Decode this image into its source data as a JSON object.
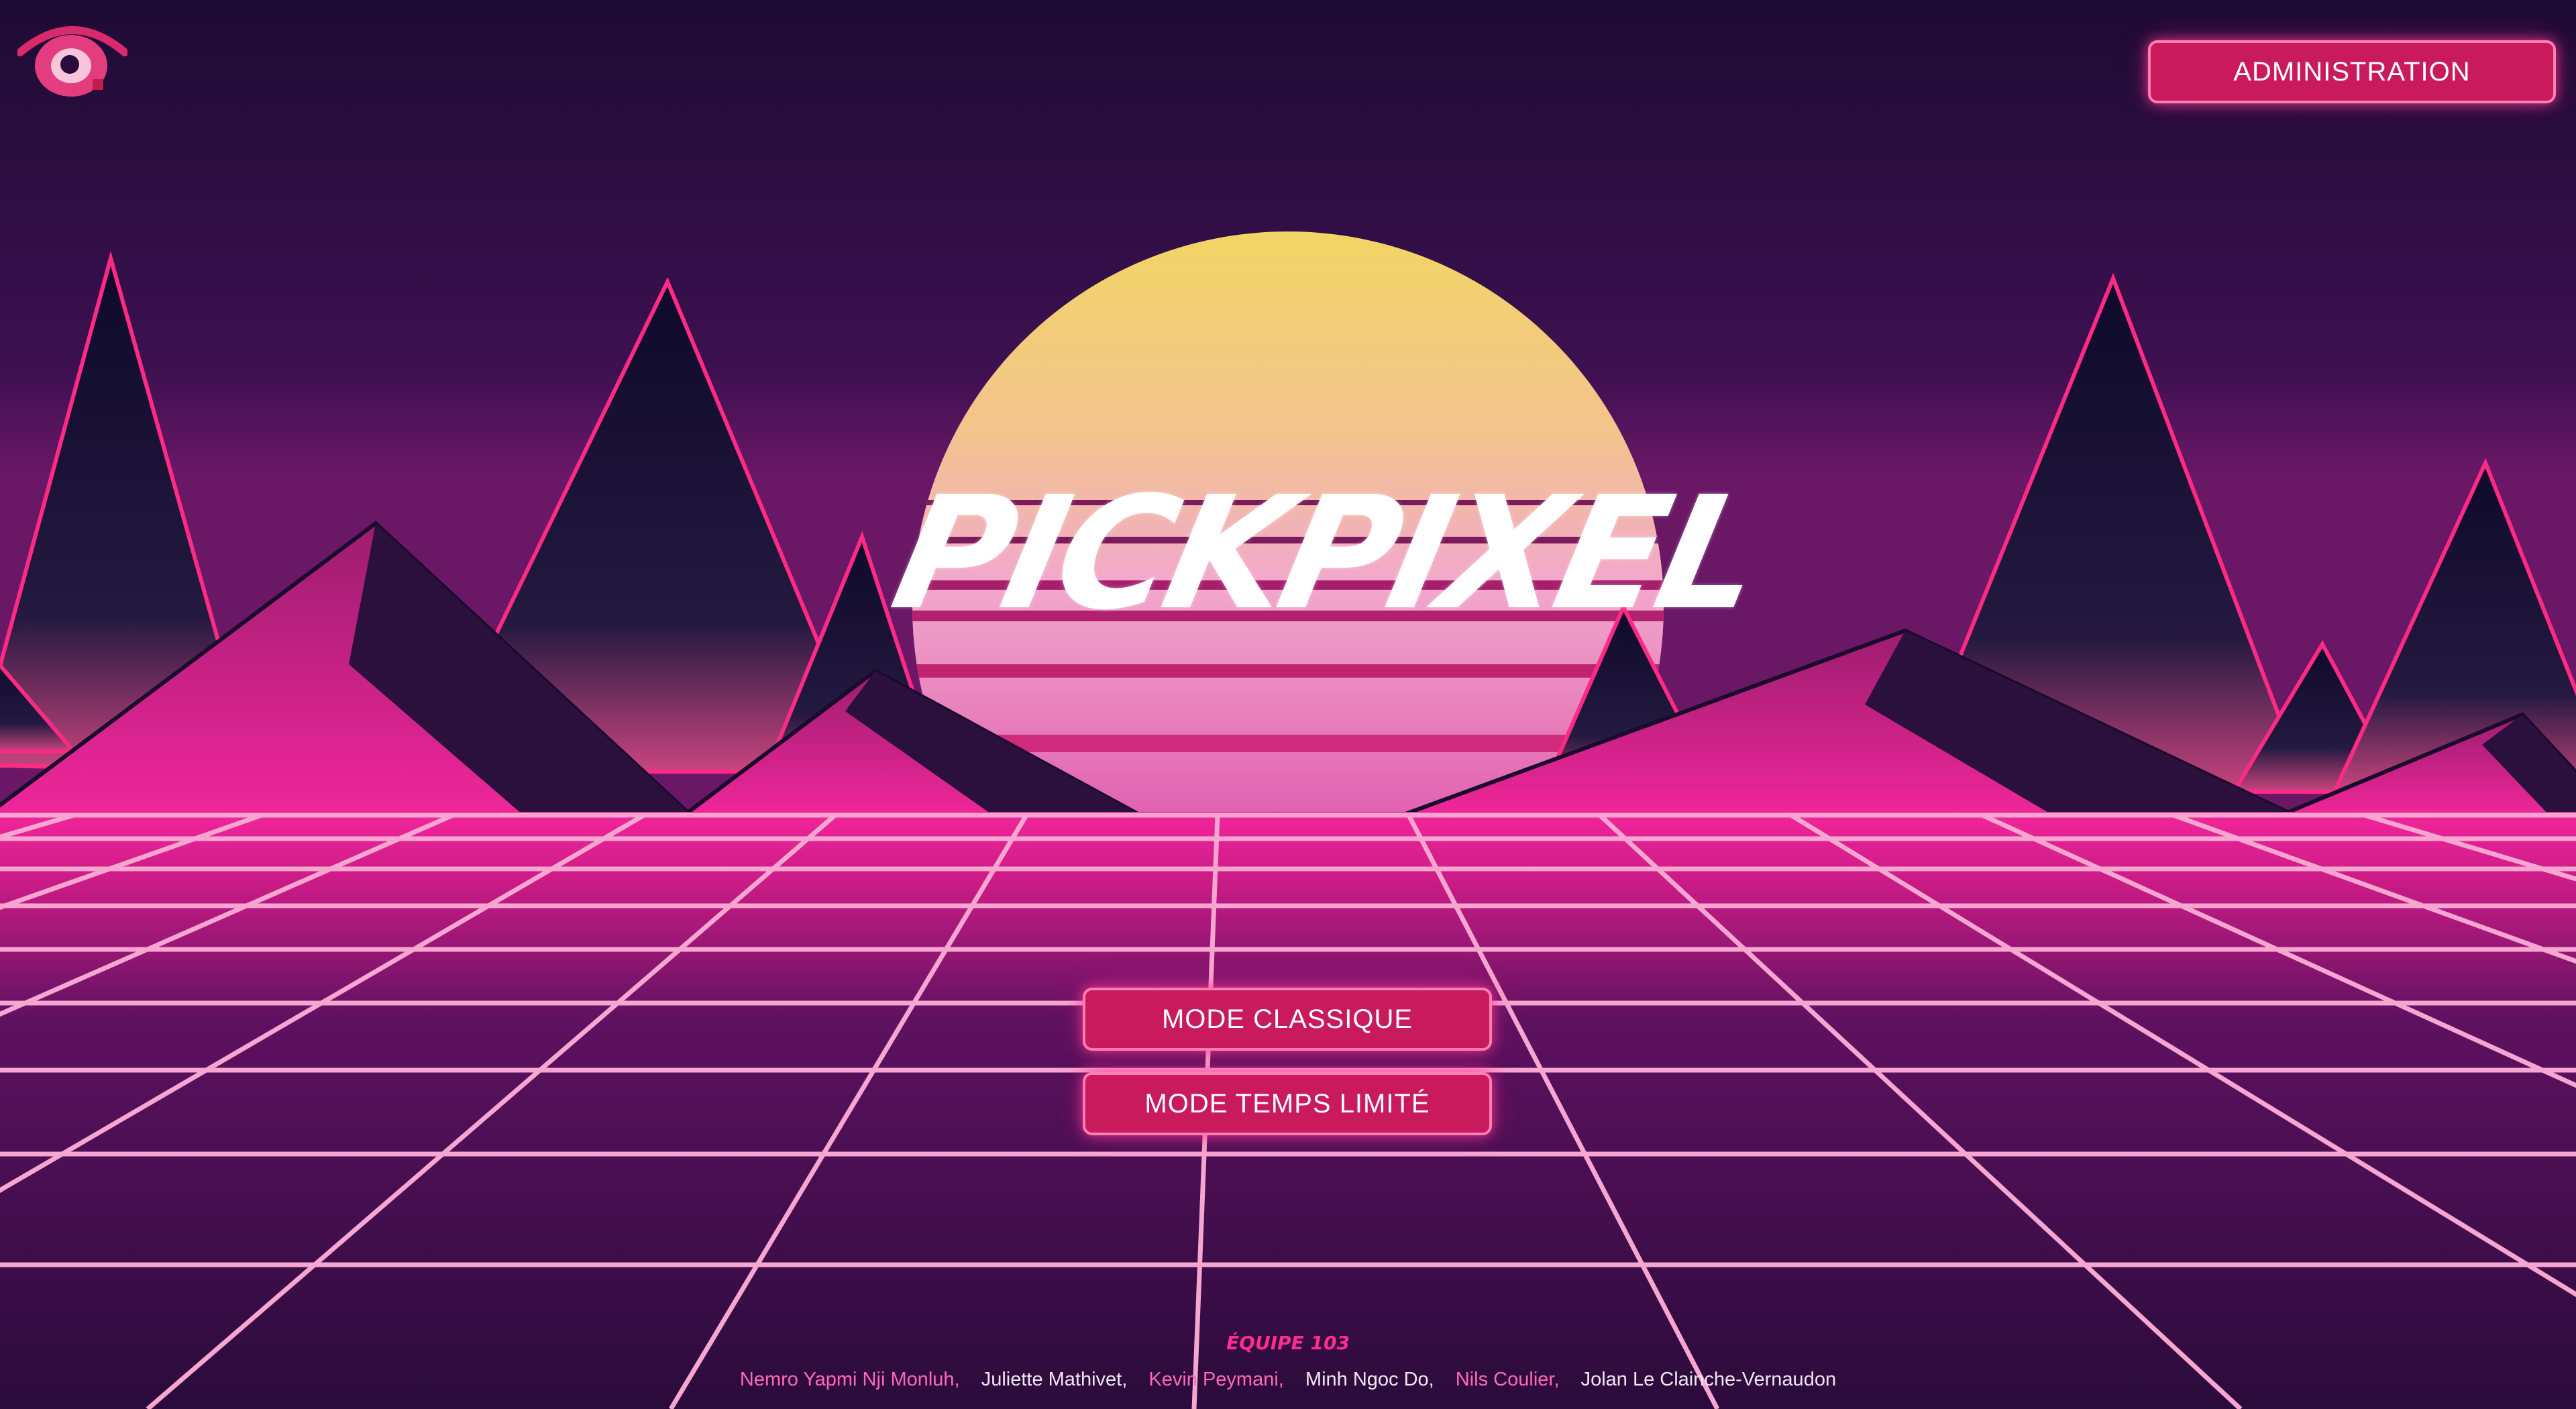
{
  "header": {
    "logo_icon": "eye-pin-logo-icon",
    "admin_label": "ADMINISTRATION"
  },
  "hero": {
    "title": "PICKPIXEL"
  },
  "modes": {
    "classic_label": "MODE CLASSIQUE",
    "timed_label": "MODE TEMPS LIMITÉ"
  },
  "footer": {
    "team": "ÉQUIPE 103",
    "members": [
      "Nemro Yapmi Nji Monluh,",
      "Juliette Mathivet,",
      "Kevin Peymani,",
      "Minh Ngoc Do,",
      "Nils Coulier,",
      "Jolan Le Clainche-Vernaudon"
    ]
  },
  "colors": {
    "button_bg": "#c81a5c",
    "button_border": "#ff7fb0",
    "sky_top": "#1c0b30",
    "neon_pink": "#ff2d8f",
    "sun_yellow": "#f2d466",
    "sun_pink": "#e98bc2"
  }
}
